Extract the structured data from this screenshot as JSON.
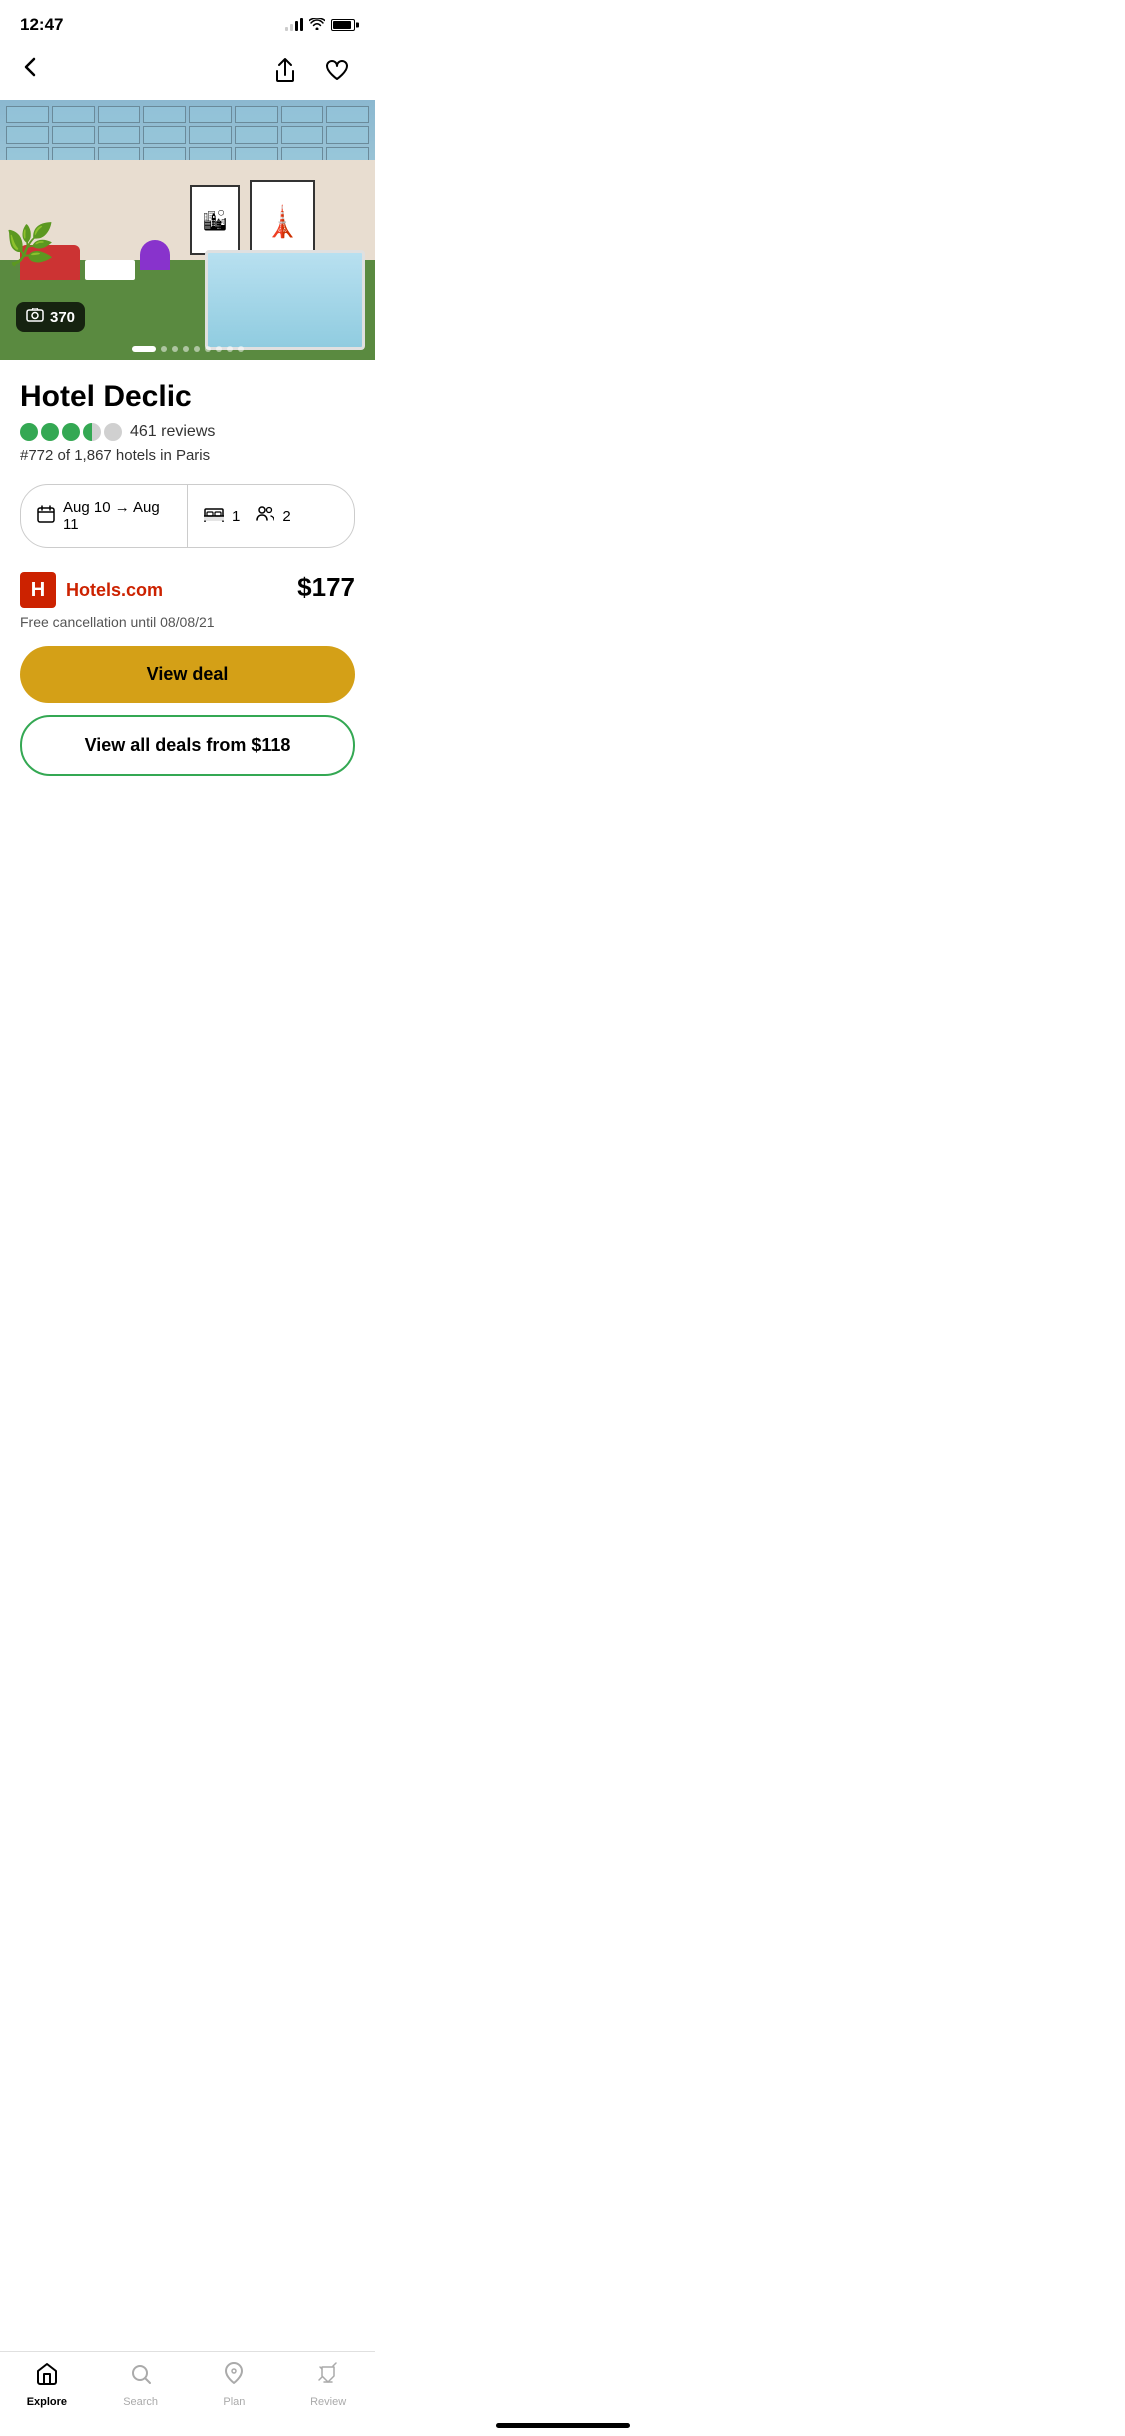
{
  "status": {
    "time": "12:47",
    "signal_bars": [
      2,
      3,
      4
    ],
    "battery_level": 90
  },
  "nav": {
    "back_label": "‹",
    "share_label": "share",
    "favorite_label": "heart"
  },
  "hotel_image": {
    "photo_count": "370",
    "photo_icon": "🖼"
  },
  "hotel": {
    "name": "Hotel Declic",
    "rating_filled": 4,
    "rating_empty": 1,
    "review_count": "461 reviews",
    "rank": "#772 of 1,867 hotels in Paris"
  },
  "selector": {
    "date_icon": "📅",
    "date_value": "Aug 10 → Aug 11",
    "room_icon": "🛏",
    "room_count": "1",
    "guest_icon": "👥",
    "guest_count": "2"
  },
  "provider": {
    "logo_letter": "H",
    "name": "Hotels.com",
    "price": "$177",
    "cancellation": "Free cancellation until 08/08/21"
  },
  "buttons": {
    "view_deal": "View deal",
    "view_all_deals": "View all deals from $118"
  },
  "bottom_nav": {
    "items": [
      {
        "id": "explore",
        "label": "Explore",
        "icon": "🏠",
        "active": true
      },
      {
        "id": "search",
        "label": "Search",
        "icon": "🔍",
        "active": false
      },
      {
        "id": "plan",
        "label": "Plan",
        "icon": "♡",
        "active": false
      },
      {
        "id": "review",
        "label": "Review",
        "icon": "✏",
        "active": false
      }
    ]
  },
  "carousel": {
    "total_dots": 9,
    "active_dot": 0
  }
}
